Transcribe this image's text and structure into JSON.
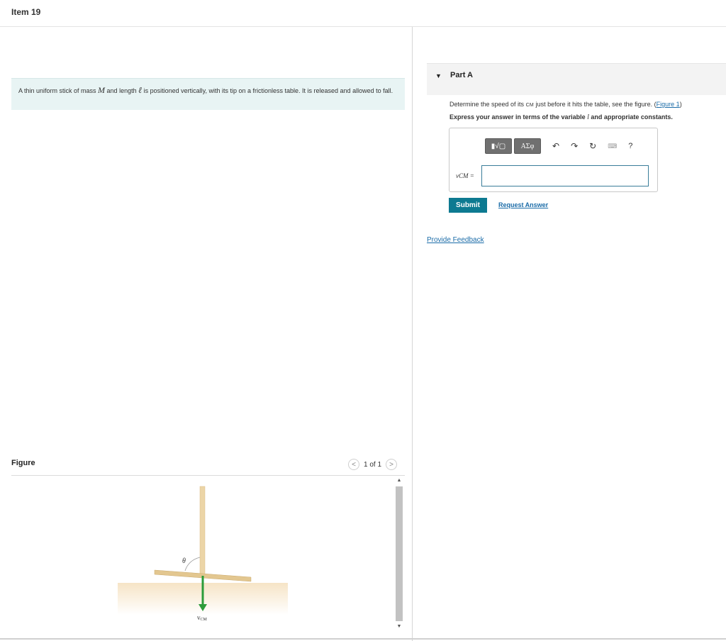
{
  "header": {
    "title": "Item 19"
  },
  "problem": {
    "text_1": "A thin uniform stick of mass ",
    "var_mass": "M",
    "text_2": " and length ",
    "var_length": "ℓ",
    "text_3": " is positioned vertically, with its tip on a frictionless table. It is released and allowed to fall."
  },
  "figure": {
    "label": "Figure",
    "pager": "1 of 1",
    "prev": "<",
    "next": ">",
    "angle_label": "θ",
    "velocity_label": "v",
    "velocity_sub": "CM",
    "colors": {
      "stick": "#ecd5a7",
      "table": "#f6e4c6",
      "arrow": "#2c9c3a"
    }
  },
  "partA": {
    "title": "Part A",
    "question_1": "Determine the speed of its ",
    "question_cm": "CM",
    "question_2": " just before it hits the table, see the figure. (",
    "figure_link": "Figure 1",
    "question_3": ")",
    "express_1": "Express your answer in terms of the variable ",
    "express_var": "l",
    "express_2": " and appropriate constants.",
    "toolbar": {
      "templates_label": "▮√▢",
      "symbols_label": "ΑΣφ",
      "undo": "↶",
      "redo": "↷",
      "reset": "↻",
      "keyboard": "⌨",
      "help": "?"
    },
    "input_label": "vCM =",
    "input_value": "",
    "submit": "Submit",
    "request_answer": "Request Answer"
  },
  "feedback": "Provide Feedback"
}
